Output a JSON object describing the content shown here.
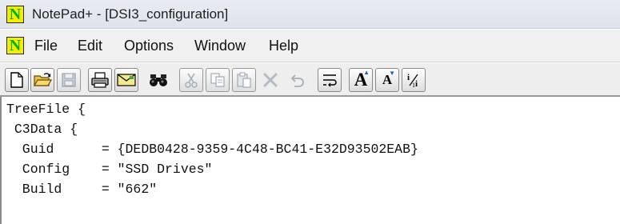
{
  "window": {
    "title": "NotePad+ - [DSI3_configuration]",
    "logo_letter": "N"
  },
  "menu": {
    "logo_letter": "N",
    "items": [
      "File",
      "Edit",
      "Options",
      "Window",
      "Help"
    ]
  },
  "toolbar": {
    "buttons": [
      {
        "icon": "new-file-icon"
      },
      {
        "icon": "open-folder-icon"
      },
      {
        "icon": "save-disk-icon"
      },
      {
        "icon": "print-icon"
      },
      {
        "icon": "mail-icon"
      },
      {
        "icon": "find-binoculars-icon"
      },
      {
        "icon": "cut-icon"
      },
      {
        "icon": "copy-icon"
      },
      {
        "icon": "paste-icon"
      },
      {
        "icon": "delete-icon"
      },
      {
        "icon": "undo-icon"
      },
      {
        "icon": "word-wrap-icon"
      },
      {
        "icon": "font-larger-icon",
        "text": "A"
      },
      {
        "icon": "font-smaller-icon",
        "text": "A"
      },
      {
        "icon": "fraction-icon",
        "text": "i/i"
      }
    ]
  },
  "editor": {
    "lines": [
      "TreeFile {",
      " C3Data {",
      "  Guid      = {DEDB0428-9359-4C48-BC41-E32D93502EAB}",
      "  Config    = \"SSD Drives\"",
      "  Build     = \"662\""
    ]
  },
  "colors": {
    "logo_background": "#f5ec00",
    "logo_letter": "#00b300",
    "disabled_icon": "#9aa4b4"
  }
}
